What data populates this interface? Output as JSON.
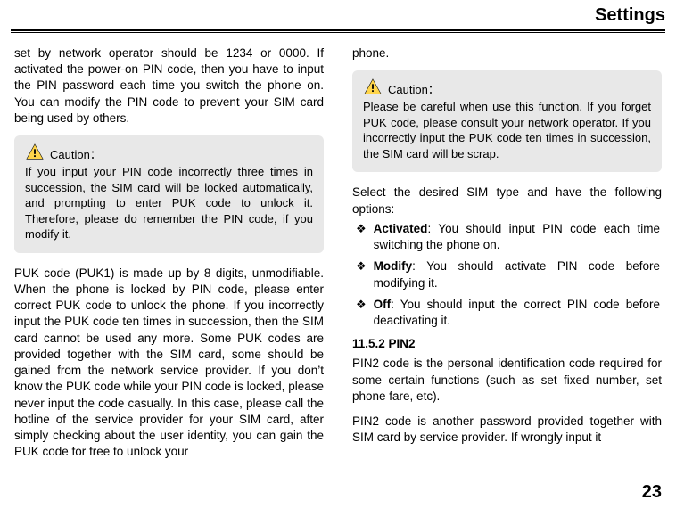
{
  "header": {
    "title": "Settings"
  },
  "col1": {
    "p1": "set by network operator should be 1234 or 0000. If activated the power-on PIN code, then you have to input the PIN password each time you switch the phone on. You can modify the PIN code to prevent your SIM card being used by others.",
    "caution_label": "Caution：",
    "caution_text": "If you input your PIN code incorrectly three times in succession, the SIM card will be locked automatically, and prompting to enter PUK code to unlock it. Therefore, please do remember the PIN code, if you modify it.",
    "p2": "PUK code (PUK1) is made up by 8 digits, unmodifiable. When the phone is locked by PIN code, please enter correct PUK code to unlock the phone. If you incorrectly input the PUK code ten times in succession, then the SIM card cannot be used any more. Some PUK codes are provided together with the SIM card, some should be gained from the network service provider. If you don’t know the PUK code while your PIN code is locked, please never input the code casually. In this case, please call the hotline of the service provider for your SIM card, after simply checking about the user identity, you can gain the PUK code for free to unlock your"
  },
  "col2": {
    "p1": "phone.",
    "caution_label": "Caution：",
    "caution_text": "Please be careful when use this function. If you forget PUK code, please consult your network operator. If you incorrectly input the PUK code ten times in succession, the SIM card will be scrap.",
    "p2": "Select the desired SIM type and have the following options:",
    "options": [
      {
        "label": "Activated",
        "text": ": You should input PIN code each time switching the phone on."
      },
      {
        "label": "Modify",
        "text": ": You should activate PIN code before modifying it."
      },
      {
        "label": "Off",
        "text": ": You should input the correct PIN code before deactivating it."
      }
    ],
    "subhead": "11.5.2 PIN2",
    "p3": "PIN2 code is the personal identification code required for some certain functions (such as set fixed number, set phone fare, etc).",
    "p4": "PIN2 code is another password provided together with SIM card by service provider. If wrongly input it"
  },
  "pagenum": "23",
  "bullet": "❖"
}
